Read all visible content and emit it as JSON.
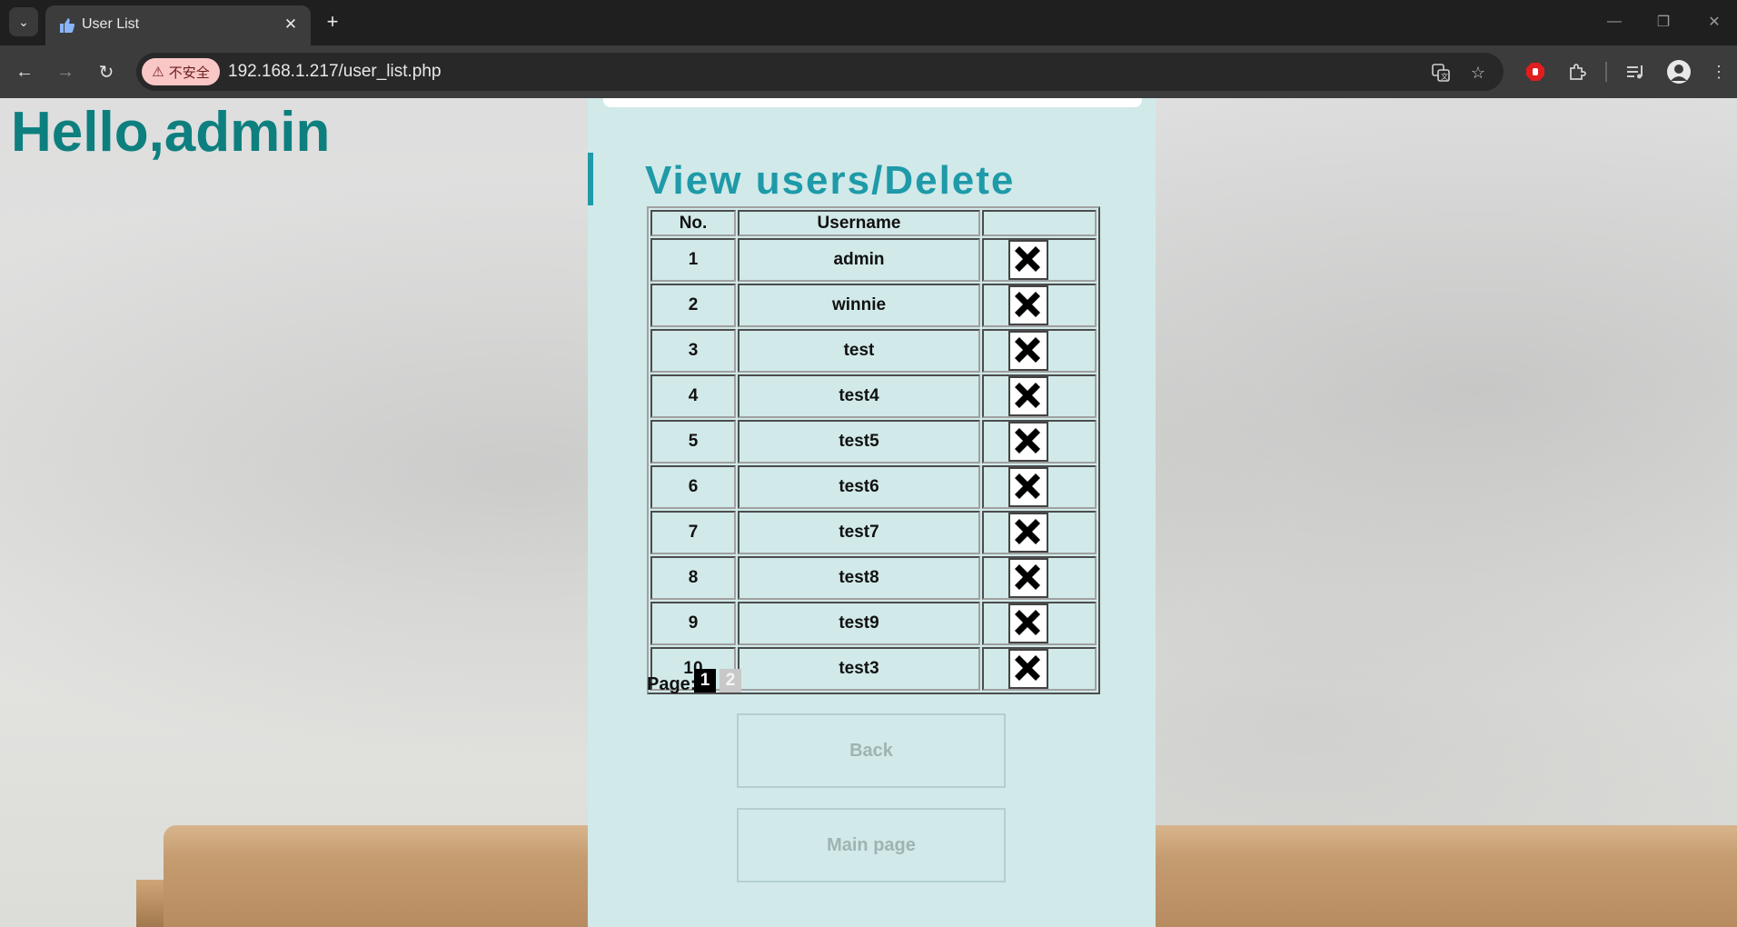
{
  "browser": {
    "tab_title": "User List",
    "security_label": "不安全",
    "url": "192.168.1.217/user_list.php"
  },
  "page": {
    "greeting": "Hello,admin",
    "heading": "View users/Delete",
    "table": {
      "headers": [
        "No.",
        "Username",
        ""
      ],
      "rows": [
        {
          "no": "1",
          "username": "admin"
        },
        {
          "no": "2",
          "username": "winnie"
        },
        {
          "no": "3",
          "username": "test"
        },
        {
          "no": "4",
          "username": "test4"
        },
        {
          "no": "5",
          "username": "test5"
        },
        {
          "no": "6",
          "username": "test6"
        },
        {
          "no": "7",
          "username": "test7"
        },
        {
          "no": "8",
          "username": "test8"
        },
        {
          "no": "9",
          "username": "test9"
        },
        {
          "no": "10",
          "username": "test3"
        }
      ],
      "delete_icon": "x-icon"
    },
    "pagination": {
      "label": "Page:",
      "pages": [
        "1",
        "2"
      ],
      "current": "1"
    },
    "buttons": {
      "back": "Back",
      "main_page": "Main page"
    }
  },
  "colors": {
    "accent": "#1e9aa8",
    "greeting": "#0e7f7f",
    "panel": "#d1e9e9"
  }
}
